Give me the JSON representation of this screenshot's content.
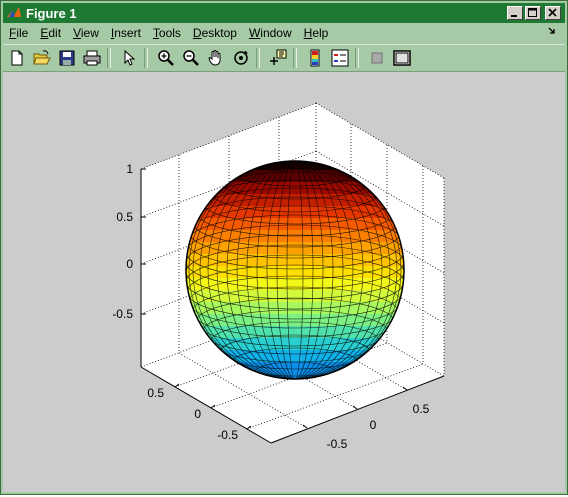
{
  "window": {
    "title": "Figure 1"
  },
  "menubar": {
    "items": [
      {
        "mnemonic": "F",
        "rest": "ile"
      },
      {
        "mnemonic": "E",
        "rest": "dit"
      },
      {
        "mnemonic": "V",
        "rest": "iew"
      },
      {
        "mnemonic": "I",
        "rest": "nsert"
      },
      {
        "mnemonic": "T",
        "rest": "ools"
      },
      {
        "mnemonic": "D",
        "rest": "esktop"
      },
      {
        "mnemonic": "W",
        "rest": "indow"
      },
      {
        "mnemonic": "H",
        "rest": "elp"
      }
    ]
  },
  "toolbar": {
    "buttons": [
      "new-figure",
      "open-file",
      "save",
      "print",
      "edit-plot",
      "zoom-in",
      "zoom-out",
      "pan",
      "rotate-3d",
      "data-cursor",
      "insert-colorbar",
      "insert-legend",
      "hide-plot-tools",
      "show-plot-tools"
    ]
  },
  "plot": {
    "type": "sphere surface",
    "colormap": "jet",
    "z_ticks": [
      "1",
      "0.5",
      "0",
      "-0.5"
    ],
    "x_ticks": [
      "0.5",
      "0",
      "-0.5"
    ],
    "y_ticks": [
      "0.5",
      "0",
      "-0.5"
    ]
  }
}
